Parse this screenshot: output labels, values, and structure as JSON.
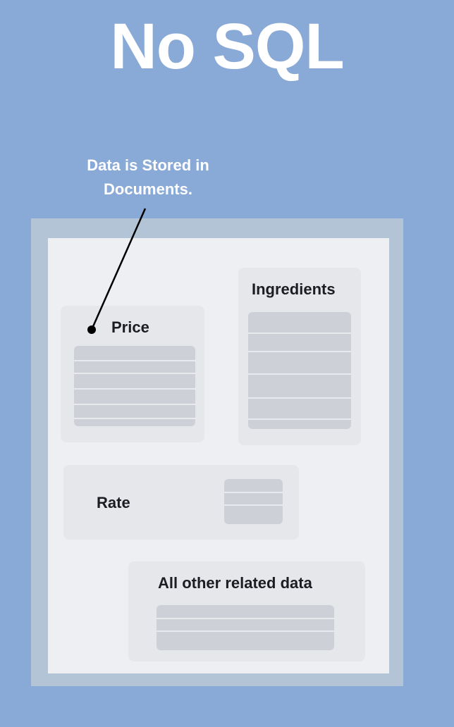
{
  "title": "No SQL",
  "callout": {
    "line1": "Data is Stored in",
    "line2": "Documents."
  },
  "document": {
    "cards": {
      "price": {
        "label": "Price"
      },
      "ingredients": {
        "label": "Ingredients"
      },
      "rate": {
        "label": "Rate"
      },
      "other": {
        "label": "All other related data"
      }
    }
  },
  "colors": {
    "background": "#89a9d6",
    "frame": "#b4c4d7",
    "document": "#edeff3",
    "card": "#e5e7eb",
    "field": "#cdd0d7",
    "text": "#1b1d22"
  }
}
